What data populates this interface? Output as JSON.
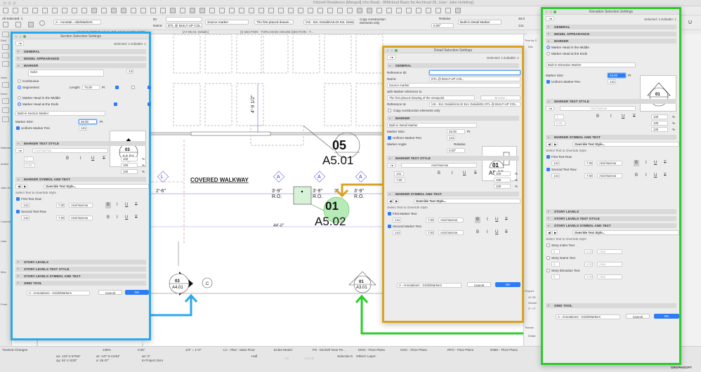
{
  "window": {
    "title": "Kitchell Residence [Merged] (rho Boat) - BIMcloud Basic for Archicad 25, User: Jake Hofeling]"
  },
  "infobox": {
    "all_selected": "All Selected: 1",
    "layer": "A - Annotati...rids/Markers",
    "id_label": "ID:",
    "id_value": "",
    "name_label": "Name:",
    "name_value": "DTL @ BUILT-UP COL.",
    "source_marker": "Source marker",
    "first_placed": "The first placed drawin...",
    "reference_path": "\\A5 - Ext. Details\\A5.02 Ext. Details",
    "copy_construction": "Copy construction elements only",
    "relative": "Relative",
    "angle": "0.00°",
    "marker_type": "Built-in Detail Marker",
    "marker_size": "46.0",
    "pen": "141",
    "u_label": "U"
  },
  "tabs": [
    {
      "label": "MAIN FLOOR PLAN (1. T.O. MAIN SUBFLOOR)"
    },
    {
      "label": "[A7.05 Int. Details]"
    },
    {
      "label": "(I) SECTION - THRU MAIN HOUSE [SECTION - T..."
    }
  ],
  "left_toolbox": {
    "labels": [
      "Desi",
      "View",
      "Docu",
      "Reference",
      "Active:",
      "Jake Ho",
      "Colored",
      "User",
      "Mes",
      "From"
    ]
  },
  "drawing": {
    "up_label": "UP",
    "dim_vertical": "4'-9 1/2\"",
    "callout_05": {
      "number": "05",
      "sheet": "A5.01"
    },
    "callout_01": {
      "number": "01",
      "sheet": "A5.02"
    },
    "grid_L": "L",
    "grid_A": "A",
    "grid_C": "C",
    "dim_2_6": "2'-6\"",
    "dim_ro": "3'-9\"",
    "ro_label": "R.O.",
    "dim_3": "3\"",
    "covered_walkway": "COVERED WALKWAY",
    "dim_44": "44'-0\"",
    "section_marker": {
      "number": "03",
      "sheet": "A4.01"
    },
    "elevation_marker": {
      "number": "01",
      "sheet": "A3.01"
    }
  },
  "section_dialog": {
    "title": "Section Selection Settings",
    "selected": "Selected: 1 Editable: 1",
    "sections": {
      "general": "GENERAL",
      "model_appearance": "MODEL APPEARANCE",
      "marker": "MARKER",
      "marker_text_style": "MARKER TEXT STYLE",
      "marker_symbol": "MARKER SYMBOL AND TEXT",
      "story_levels": "STORY LEVELS",
      "story_levels_text": "STORY LEVELS TEXT STYLE",
      "story_levels_symbol": "STORY LEVELS SYMBOL AND TEXT",
      "grid_tool": "GRID TOOL"
    },
    "line_type": "Solid",
    "pen": "141",
    "continuous": "Continuous",
    "segmented": "Segmented",
    "length_label": "Length:",
    "length_value": "75.00",
    "unit_pt": "Pt",
    "head_middle": "Marker Head in the Middle",
    "head_ends": "Marker Head at the Ends",
    "marker_type": "Built-in Section Marker",
    "marker_size_label": "Marker Size:",
    "marker_size": "46.00",
    "uniform_pen": "Uniform Marker Pen",
    "font": "Arial Narrow",
    "text_pen": "7",
    "text_size": "0.00",
    "pct1": "100",
    "pct2": "100",
    "pct3": "100",
    "pct": "%",
    "override": "Override Text Style...",
    "select_text": "Select Text to Override Style",
    "row1": "First Text Row",
    "row2": "Second Text Row",
    "row_pen": "141",
    "row_size": "7.00",
    "row_font": "Arial Narrow",
    "layer": "A - Annotations - Grids/Markers",
    "cancel": "Cancel",
    "ok": "OK",
    "preview": {
      "number": "03",
      "sheet": "A4.01"
    }
  },
  "detail_dialog": {
    "title": "Detail Selection Settings",
    "selected": "Selected: 1 Editable: 1",
    "general": "GENERAL",
    "ref_id_label": "Reference ID:",
    "ref_id_value": "",
    "name_label": "Name:",
    "name_value": "DTL @ BUILT-UP COL.",
    "source_marker": "Source marker",
    "with_marker_ref": "with Marker reference to",
    "first_placed": "The first placed drawing of the viewpoint",
    "browse": "Browse...",
    "ref_to_label": "Reference to:",
    "ref_to_value": "\\A5 - Ext. Details\\A5.02 Ext. Details\\01 DTL @ BUILT-UP COL.",
    "copy_construction": "Copy construction elements only",
    "marker": "MARKER",
    "marker_type": "Built-in Detail Marker",
    "marker_size_label": "Marker Size:",
    "marker_size": "46.00",
    "unit_pt": "Pt",
    "uniform_pen": "Uniform Marker Pen",
    "pen": "141",
    "marker_angle": "Marker Angle:",
    "relative": "Relative",
    "angle": "0.00°",
    "marker_text_style": "MARKER TEXT STYLE",
    "font": "Arial Narrow",
    "text_pen": "141",
    "text_size": "7.00",
    "pct1": "100",
    "pct2": "100",
    "pct3": "100",
    "pct": "%",
    "marker_symbol": "MARKER SYMBOL AND TEXT",
    "override": "Override Text Style...",
    "select_text": "Select Text to Override Style",
    "row1": "First Marker Text",
    "row2": "Second Marker Text",
    "row_pen": "141",
    "row_size": "7.00",
    "row_font": "Arial Narrow",
    "layer": "A - Annotations - Grids/Markers",
    "cancel": "Cancel",
    "ok": "OK",
    "preview": {
      "number": "01",
      "sheet": "A5.02"
    }
  },
  "elevation_dialog": {
    "title": "Elevation Selection Settings",
    "selected": "Selected: 1 Editable: 1",
    "general": "GENERAL",
    "model_appearance": "MODEL APPEARANCE",
    "marker": "MARKER",
    "head_middle": "Marker Head in the Middle",
    "head_ends": "Marker Head at the Ends",
    "marker_type": "Built-in Elevation Marker",
    "marker_size_label": "Marker Size:",
    "marker_size": "46.00",
    "unit_pt": "Pt",
    "uniform_pen": "Uniform Marker Pen",
    "pen": "141",
    "marker_text_style": "MARKER TEXT STYLE",
    "font": "Arial Narrow",
    "text_pen": "7",
    "text_size": "0.00",
    "pct1": "100",
    "pct2": "100",
    "pct3": "100",
    "pct": "%",
    "marker_symbol": "MARKER SYMBOL AND TEXT",
    "override": "Override Text Style...",
    "select_text": "Select Text to Override Style",
    "row1": "First Text Row",
    "row2": "Second Text Row",
    "row_pen": "141",
    "row_size": "7.00",
    "row_font": "Arial Narrow",
    "story_levels": "STORY LEVELS",
    "story_levels_text": "STORY LEVELS TEXT STYLE",
    "story_levels_symbol": "STORY LEVELS SYMBOL AND TEXT",
    "story_select_text": "Select Text to Override Style",
    "story_index": "Story Index Text",
    "story_name": "Story Name Text",
    "story_elev": "Story Elevation Text",
    "story_pen": "6",
    "story_size": "3.00",
    "story_font": "Arial",
    "grid_tool": "GRID TOOL",
    "layer": "A - Annotations - Grids/Markers",
    "cancel": "Cancel",
    "ok": "OK",
    "preview": {
      "number": "01",
      "sheet": "A3.01"
    }
  },
  "navigator": {
    "tree_label": "Tree by S",
    "root": "Kitc",
    "properties": "Propert",
    "prop1": "A7.05",
    "prop2": "Kitchel",
    "prop3": "3\" / 3\"",
    "teamwork": "Teamw",
    "editable": "Editat"
  },
  "statusbar": {
    "tracked_changes": "Tracked Changes",
    "zoom": "139%",
    "angle": "0.00°",
    "scale": "1/4\" = 1'-0\"",
    "layer_combo": "LC - Plan - Main Floor",
    "model": "Entire Model",
    "pen_set": "PS - Kitchell View Pe...",
    "mvo": "MVO - Floor Plans",
    "goc": "GOC - Floor Plans",
    "rfo": "RFO - Floor Plans",
    "dims": "DIMS - Floor Plans",
    "coord_x": "Δx: 123'-2 57/64\"",
    "coord_y": "Δy: 61'-1 5/32\"",
    "coord_r": "Δr: 137'-6 41/64\"",
    "coord_a": "a: 26.37°",
    "dz": "Δz: 0\"",
    "project_zero": "to Project Zero",
    "half": "Half",
    "ok": "OK",
    "cancel": "Cancel",
    "selections": "Selection's",
    "others_layer": "Others' Layer:",
    "brand": "GRAPHISOFT"
  }
}
